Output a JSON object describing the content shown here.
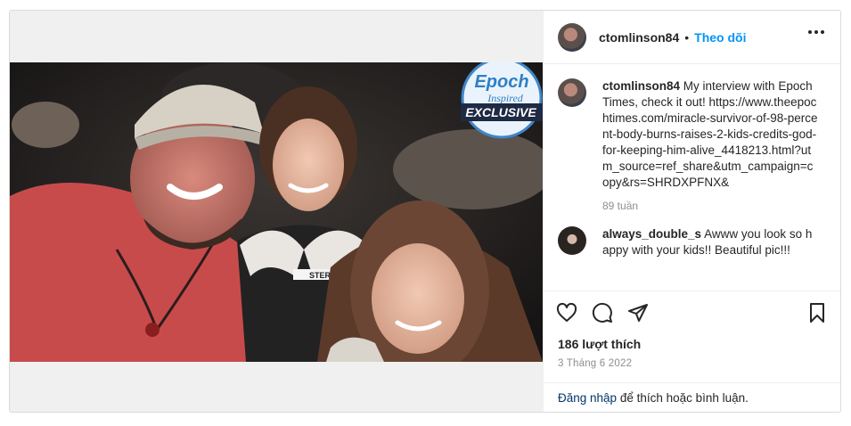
{
  "post": {
    "username": "ctomlinson84",
    "dot": "•",
    "follow_label": "Theo dõi",
    "more_icon": "more-horizontal-icon"
  },
  "photo": {
    "badge_line1": "Epoch",
    "badge_line2": "Inspired",
    "badge_line3": "EXCLUSIVE",
    "shirt_text": "STER",
    "colors": {
      "badge_blue": "#3f86c9",
      "red_shirt": "#c84b4b"
    }
  },
  "caption": {
    "username": "ctomlinson84",
    "text": "My interview with Epoch Times, check it out! https://www.theepochtimes.com/miracle-survivor-of-98-percent-body-burns-raises-2-kids-credits-god-for-keeping-him-alive_4418213.html?utm_source=ref_share&utm_campaign=copy&rs=SHRDXPFNX&",
    "time": "89 tuần"
  },
  "comments": [
    {
      "username": "always_double_s",
      "text": "Awww you look so happy with your kids!! Beautiful pic!!!"
    }
  ],
  "actions": {
    "like_icon": "heart-icon",
    "comment_icon": "comment-icon",
    "share_icon": "send-icon",
    "save_icon": "bookmark-icon"
  },
  "likes": "186 lượt thích",
  "date": "3 Tháng 6 2022",
  "login": {
    "link": "Đăng nhập",
    "rest": " để thích hoặc bình luận."
  }
}
